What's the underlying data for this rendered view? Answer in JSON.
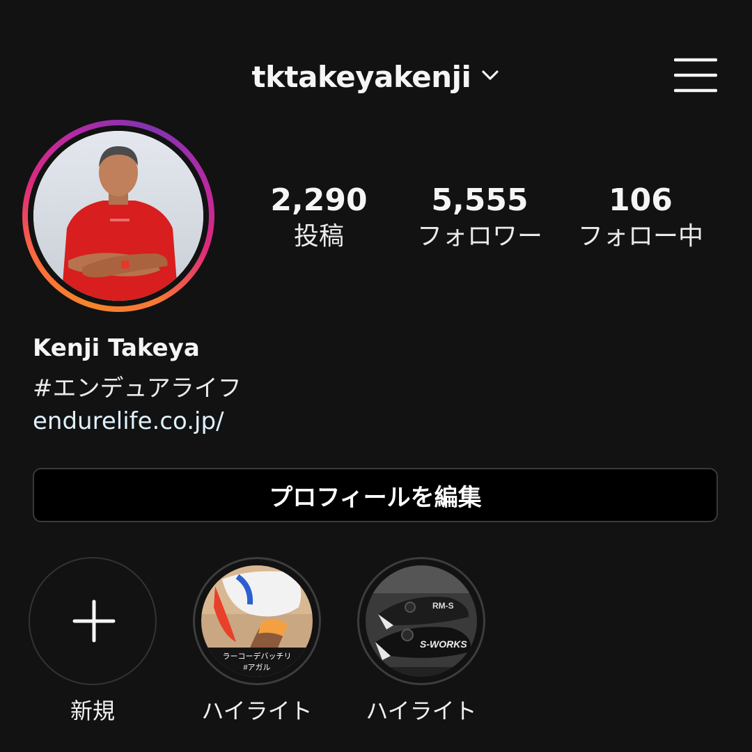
{
  "header": {
    "username": "tktakeyakenji"
  },
  "stats": [
    {
      "value": "2,290",
      "label": "投稿"
    },
    {
      "value": "5,555",
      "label": "フォロワー"
    },
    {
      "value": "106",
      "label": "フォロー中"
    }
  ],
  "bio": {
    "name": "Kenji Takeya",
    "hashtag": "#エンデュアライフ",
    "link": "endurelife.co.jp/"
  },
  "edit_button_label": "プロフィールを編集",
  "highlights": {
    "new_label": "新規",
    "items": [
      {
        "label": "ハイライト",
        "caption_line1": "ラーコーデバッチリ",
        "caption_line2": "#アガル"
      },
      {
        "label": "ハイライト",
        "caption_brand1": "S-WORKS",
        "caption_brand2": "RM-S"
      }
    ]
  },
  "colors": {
    "background": "#121212",
    "story_ring_start": "#f58529",
    "story_ring_end": "#8134af",
    "button_border": "#3a3a3a"
  },
  "icons": [
    "chevron-down-icon",
    "hamburger-menu-icon",
    "plus-icon"
  ]
}
